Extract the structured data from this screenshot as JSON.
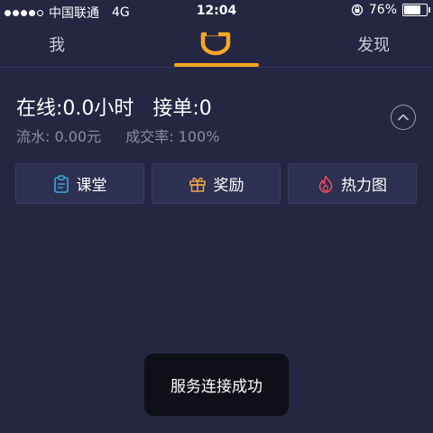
{
  "status_bar": {
    "carrier": "中国联通",
    "network": "4G",
    "time": "12:04",
    "battery": "76%",
    "battery_level": 0.76
  },
  "nav": {
    "me": "我",
    "discover": "发现",
    "logo_icon": "didi-logo-icon",
    "accent_color": "#f5a623"
  },
  "stats": {
    "online_line": "在线:0.0小时   接单:0",
    "flow": "流水: 0.00元",
    "rate": "成交率: 100%"
  },
  "features": [
    {
      "label": "课堂",
      "icon": "clipboard-icon",
      "color": "#3aa7e0"
    },
    {
      "label": "奖励",
      "icon": "gift-icon",
      "color": "#f0a24b"
    },
    {
      "label": "热力图",
      "icon": "flame-icon",
      "color": "#ef4d5c"
    }
  ],
  "toast": {
    "message": "服务连接成功"
  }
}
